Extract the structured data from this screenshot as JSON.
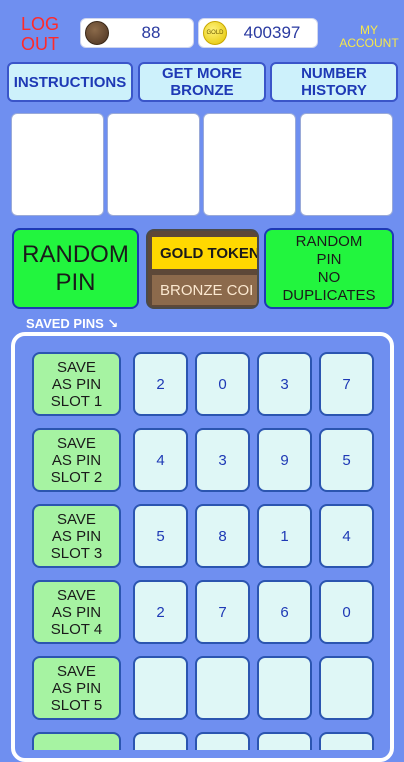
{
  "header": {
    "logout_label": "LOG\nOUT",
    "bronze_balance": "88",
    "gold_balance": "400397",
    "gold_coin_text": "GOLD",
    "account_label": "MY\nACCOUNT"
  },
  "nav": {
    "instructions": "INSTRUCTIONS",
    "get_more_bronze": "GET MORE\nBRONZE",
    "number_history": "NUMBER\nHISTORY"
  },
  "actions": {
    "random_pin": "RANDOM\nPIN",
    "gold_tokens": "GOLD TOKEN",
    "bronze_coins": "BRONZE COI",
    "random_pin_no_duplicates": "RANDOM\nPIN\nNO\nDUPLICATES"
  },
  "saved_pins_label": "SAVED PINS ↘",
  "slots": [
    {
      "label": "SAVE\nAS PIN\nSLOT 1",
      "digits": [
        "2",
        "0",
        "3",
        "7"
      ]
    },
    {
      "label": "SAVE\nAS PIN\nSLOT 2",
      "digits": [
        "4",
        "3",
        "9",
        "5"
      ]
    },
    {
      "label": "SAVE\nAS PIN\nSLOT 3",
      "digits": [
        "5",
        "8",
        "1",
        "4"
      ]
    },
    {
      "label": "SAVE\nAS PIN\nSLOT 4",
      "digits": [
        "2",
        "7",
        "6",
        "0"
      ]
    },
    {
      "label": "SAVE\nAS PIN\nSLOT 5",
      "digits": [
        "",
        "",
        "",
        ""
      ]
    },
    {
      "label": "",
      "digits": [
        "",
        "",
        "",
        ""
      ]
    }
  ],
  "colors": {
    "background": "#6f8ff0",
    "green_button": "#22f53e",
    "gold": "#ffd800",
    "bronze": "#8c6a4c"
  }
}
